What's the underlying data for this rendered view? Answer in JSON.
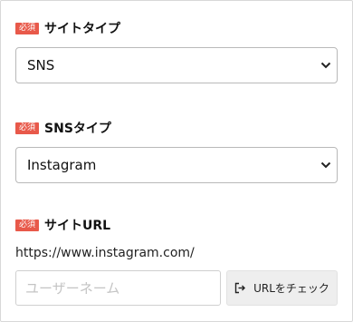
{
  "required_badge": "必須",
  "site_type": {
    "label": "サイトタイプ",
    "selected": "SNS",
    "arrow_icon": "chevron-down-icon"
  },
  "sns_type": {
    "label": "SNSタイプ",
    "selected": "Instagram",
    "arrow_icon": "chevron-down-icon"
  },
  "site_url": {
    "label": "サイトURL",
    "prefix": "https://www.instagram.com/",
    "username_placeholder": "ユーザーネーム",
    "username_value": "",
    "check_button_label": "URLをチェック",
    "check_icon": "sign-out-icon"
  },
  "colors": {
    "badge": "#e8594a",
    "button_bg": "#eeeeee",
    "border": "#b9b9b9"
  }
}
